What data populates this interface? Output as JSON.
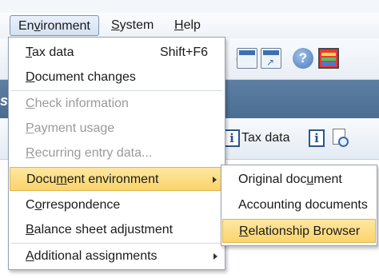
{
  "menubar": {
    "items": [
      {
        "pre": "En",
        "u": "v",
        "post": "ironment"
      },
      {
        "pre": "",
        "u": "S",
        "post": "ystem"
      },
      {
        "pre": "",
        "u": "H",
        "post": "elp"
      }
    ]
  },
  "toolbar": {
    "help_glyph": "?",
    "tool_arrow_glyph": "↗"
  },
  "title_fragment": "s",
  "appbar": {
    "info_glyph": "i",
    "tax_data_label": "Tax data"
  },
  "environment_menu": {
    "items": [
      {
        "pre": "",
        "u": "T",
        "post": "ax data",
        "shortcut": "Shift+F6",
        "state": "enabled"
      },
      {
        "pre": "",
        "u": "D",
        "post": "ocument changes",
        "state": "enabled"
      },
      {
        "pre": "",
        "u": "C",
        "post": "heck information",
        "state": "disabled"
      },
      {
        "pre": "",
        "u": "P",
        "post": "ayment usage",
        "state": "disabled"
      },
      {
        "pre": "",
        "u": "R",
        "post": "ecurring entry data...",
        "state": "disabled"
      },
      {
        "pre": "Docu",
        "u": "m",
        "post": "ent environment",
        "state": "highlighted",
        "submenu": true
      },
      {
        "pre": "C",
        "u": "o",
        "post": "rrespondence",
        "state": "enabled"
      },
      {
        "pre": "",
        "u": "B",
        "post": "alance sheet adjustment",
        "state": "enabled"
      },
      {
        "pre": "",
        "u": "A",
        "post": "dditional assignments",
        "state": "enabled",
        "submenu": true
      }
    ]
  },
  "document_environment_submenu": {
    "items": [
      {
        "pre": "Original doc",
        "u": "u",
        "post": "ment",
        "state": "enabled"
      },
      {
        "pre": "Accounting documents",
        "u": "",
        "post": "",
        "state": "enabled"
      },
      {
        "pre": "",
        "u": "R",
        "post": "elationship Browser",
        "state": "highlighted"
      }
    ]
  }
}
